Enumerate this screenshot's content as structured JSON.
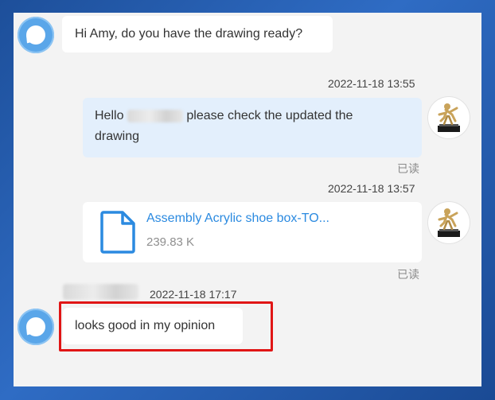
{
  "messages": [
    {
      "text": "Hi Amy, do you have the drawing ready?"
    },
    {
      "timestamp": "2022-11-18 13:55",
      "text_prefix": "Hello",
      "text_suffix": "please check the updated the",
      "text_line2": "drawing",
      "status": "已读"
    },
    {
      "timestamp": "2022-11-18 13:57",
      "file": {
        "name": "Assembly Acrylic shoe box-TO...",
        "size": "239.83 K",
        "icon": "document-icon"
      },
      "status": "已读"
    },
    {
      "timestamp": "2022-11-18 17:17",
      "text": "looks good in my opinion"
    }
  ],
  "colors": {
    "accent": "#2b8ae0",
    "highlight": "#e01515",
    "own_bubble": "#e3effc",
    "avatar": "#5aa6e9"
  }
}
